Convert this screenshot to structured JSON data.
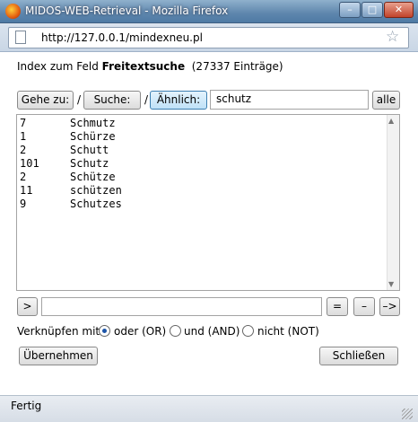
{
  "window": {
    "title": "MIDOS-WEB-Retrieval - Mozilla Firefox",
    "url": "http://127.0.0.1/mindexneu.pl",
    "controls": {
      "minimize": "–",
      "maximize": "□",
      "close": "✕"
    }
  },
  "header": {
    "prefix": "Index zum Feld",
    "field": "Freitextsuche",
    "count_text": "(27337 Einträge)"
  },
  "toolbar": {
    "gehe_zu": "Gehe zu:",
    "separator1": "/",
    "suche": "Suche:",
    "separator2": "/",
    "aehnlich": "Ähnlich:",
    "search_value": "schutz",
    "alle": "alle"
  },
  "results": [
    {
      "count": "7",
      "term": "Schmutz"
    },
    {
      "count": "1",
      "term": "Schürze"
    },
    {
      "count": "2",
      "term": "Schutt"
    },
    {
      "count": "101",
      "term": "Schutz"
    },
    {
      "count": "2",
      "term": "Schütze"
    },
    {
      "count": "11",
      "term": "schützen"
    },
    {
      "count": "9",
      "term": "Schutzes"
    }
  ],
  "combine": {
    "arrow_button": ">",
    "terms_value": "",
    "and_button": "=",
    "or_button": "–",
    "not_button": "–>",
    "label": "Verknüpfen mit",
    "options": [
      {
        "label": "oder (OR)",
        "selected": true
      },
      {
        "label": "und (AND)",
        "selected": false
      },
      {
        "label": "nicht (NOT)",
        "selected": false
      }
    ]
  },
  "actions": {
    "uebernehmen": "Übernehmen",
    "schliessen": "Schließen"
  },
  "status": {
    "text": "Fertig"
  },
  "icons": {
    "app": "firefox-icon",
    "page": "page-icon",
    "bookmark": "star-icon"
  },
  "colors": {
    "titlebar": "#5e86ad",
    "selected_button": "#bfe1f7",
    "radio_selected": "#1d55a8"
  }
}
